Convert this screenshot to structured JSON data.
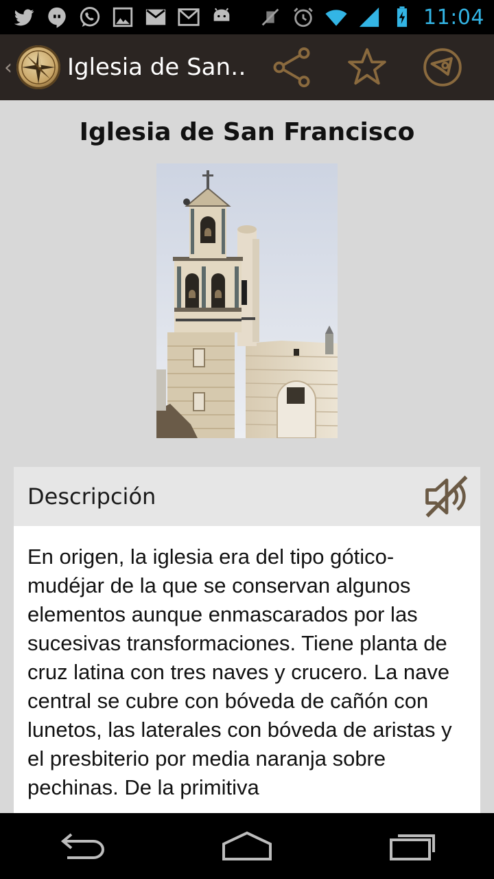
{
  "status_bar": {
    "time": "11:04",
    "left_icons": [
      "twitter-icon",
      "hangouts-icon",
      "whatsapp-icon",
      "gallery-icon",
      "gmail-icon",
      "email-icon",
      "android-icon"
    ],
    "right_icons": [
      "mute-vibrate-icon",
      "alarm-icon",
      "wifi-icon",
      "signal-icon",
      "battery-charging-icon"
    ],
    "accent_color": "#33b5e5"
  },
  "action_bar": {
    "title": "Iglesia de San…",
    "actions": [
      "share-icon",
      "star-icon",
      "map-marker-icon"
    ],
    "icon_color": "#8a6a3e"
  },
  "place": {
    "title": "Iglesia de San Francisco"
  },
  "description": {
    "header": "Descripción",
    "text": "En origen, la iglesia era del tipo gótico-mudéjar de la que se conservan algunos elementos aunque enmascarados por las sucesivas transformaciones. Tiene planta de cruz latina con tres naves y crucero. La nave central se cubre con bóveda de cañón con lunetos, las laterales con bóveda de aristas y el presbiterio por media naranja sobre pechinas. De la primitiva"
  },
  "nav_bar": {
    "buttons": [
      "back-icon",
      "home-icon",
      "recent-apps-icon"
    ]
  }
}
